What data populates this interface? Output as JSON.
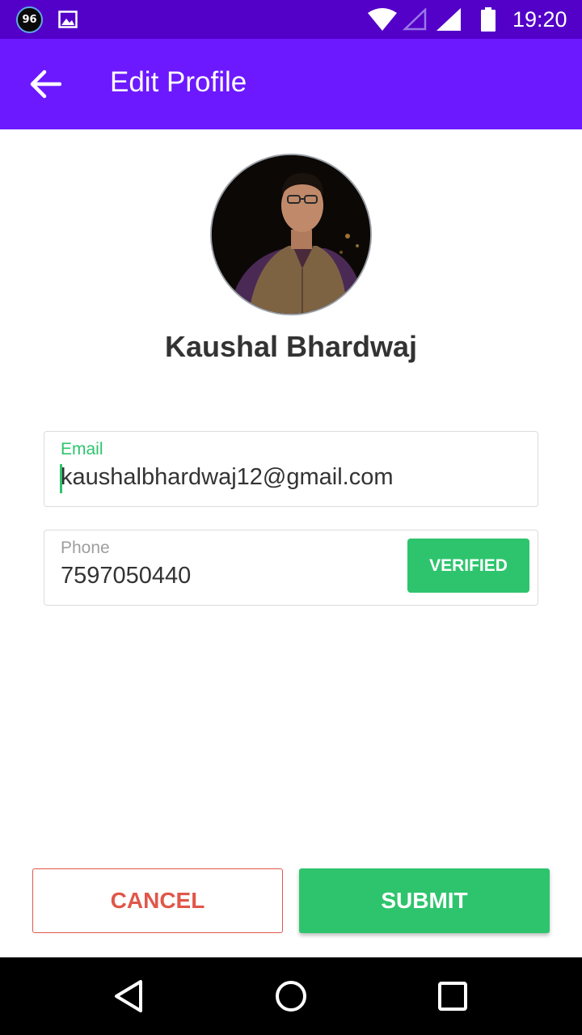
{
  "status_bar": {
    "badge_text": "96",
    "time": "19:20",
    "icons": [
      "notification-badge-icon",
      "gallery-icon",
      "wifi-icon",
      "signal-empty-icon",
      "signal-icon",
      "battery-icon"
    ]
  },
  "app_bar": {
    "title": "Edit Profile",
    "back_icon": "arrow-left-icon"
  },
  "profile": {
    "name": "Kaushal Bhardwaj"
  },
  "email": {
    "label": "Email",
    "value": "kaushalbhardwaj12@gmail.com"
  },
  "phone": {
    "label": "Phone",
    "value": "7597050440",
    "verified_label": "VERIFIED"
  },
  "actions": {
    "cancel_label": "CANCEL",
    "submit_label": "SUBMIT"
  },
  "nav_bar": {
    "icons": [
      "nav-back-icon",
      "nav-home-icon",
      "nav-recents-icon"
    ]
  },
  "colors": {
    "status_bar": "#5300c8",
    "app_bar": "#6c19ff",
    "accent_green": "#2ec46d",
    "cancel_red": "#e0574a",
    "text": "#333333"
  }
}
